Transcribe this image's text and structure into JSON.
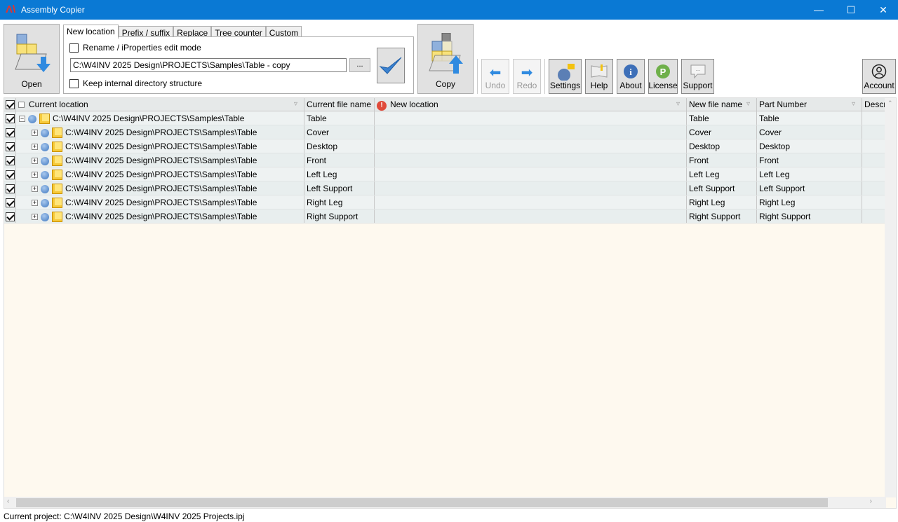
{
  "window": {
    "title": "Assembly Copier",
    "logo": "M"
  },
  "toolbar": {
    "open": "Open",
    "copy": "Copy",
    "undo": "Undo",
    "redo": "Redo",
    "settings": "Settings",
    "help": "Help",
    "about": "About",
    "license": "License",
    "support": "Support",
    "account": "Account"
  },
  "tabs": [
    "New location",
    "Prefix / suffix",
    "Replace",
    "Tree counter",
    "Custom"
  ],
  "options": {
    "rename_mode": "Rename / iProperties edit mode",
    "keep_structure": "Keep internal directory structure",
    "path": "C:\\W4INV 2025 Design\\PROJECTS\\Samples\\Table - copy",
    "browse": "..."
  },
  "grid": {
    "columns": [
      "Current location",
      "Current file name",
      "New location",
      "New file name",
      "Part Number",
      "Descr"
    ],
    "rows": [
      {
        "location": "C:\\W4INV 2025 Design\\PROJECTS\\Samples\\Table",
        "file": "Table",
        "new_location": "",
        "new_file": "Table",
        "part": "Table",
        "expander": "−"
      },
      {
        "location": "C:\\W4INV 2025 Design\\PROJECTS\\Samples\\Table",
        "file": "Cover",
        "new_location": "",
        "new_file": "Cover",
        "part": "Cover",
        "expander": "+"
      },
      {
        "location": "C:\\W4INV 2025 Design\\PROJECTS\\Samples\\Table",
        "file": "Desktop",
        "new_location": "",
        "new_file": "Desktop",
        "part": "Desktop",
        "expander": "+"
      },
      {
        "location": "C:\\W4INV 2025 Design\\PROJECTS\\Samples\\Table",
        "file": "Front",
        "new_location": "",
        "new_file": "Front",
        "part": "Front",
        "expander": "+"
      },
      {
        "location": "C:\\W4INV 2025 Design\\PROJECTS\\Samples\\Table",
        "file": "Left Leg",
        "new_location": "",
        "new_file": "Left Leg",
        "part": "Left Leg",
        "expander": "+"
      },
      {
        "location": "C:\\W4INV 2025 Design\\PROJECTS\\Samples\\Table",
        "file": "Left Support",
        "new_location": "",
        "new_file": "Left Support",
        "part": "Left Support",
        "expander": "+"
      },
      {
        "location": "C:\\W4INV 2025 Design\\PROJECTS\\Samples\\Table",
        "file": "Right Leg",
        "new_location": "",
        "new_file": "Right Leg",
        "part": "Right Leg",
        "expander": "+"
      },
      {
        "location": "C:\\W4INV 2025 Design\\PROJECTS\\Samples\\Table",
        "file": "Right Support",
        "new_location": "",
        "new_file": "Right Support",
        "part": "Right Support",
        "expander": "+"
      }
    ]
  },
  "status": "Current project: C:\\W4INV 2025 Design\\W4INV 2025 Projects.ipj"
}
